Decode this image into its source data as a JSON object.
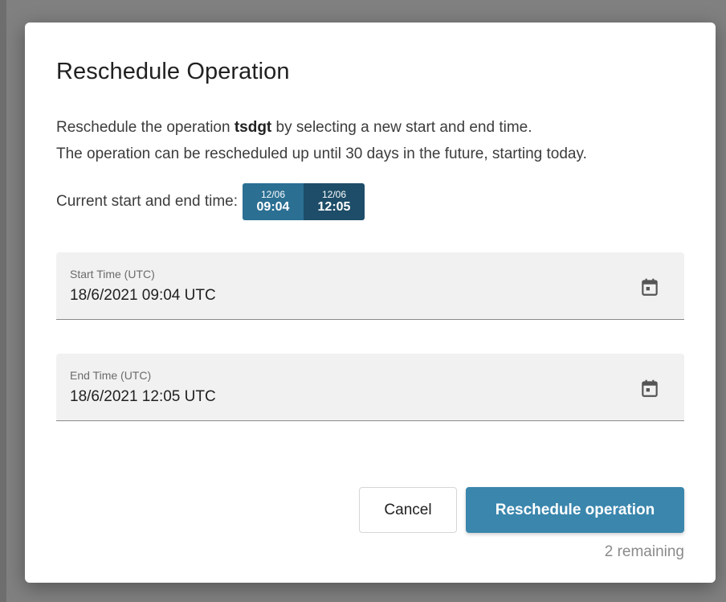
{
  "dialog": {
    "title": "Reschedule Operation",
    "description_prefix": "Reschedule the operation ",
    "operation_name": "tsdgt",
    "description_suffix": " by selecting a new start and end time.",
    "description_line2": "The operation can be rescheduled up until 30 days in the future, starting today.",
    "current_label": "Current start and end time:",
    "current_start": {
      "date": "12/06",
      "time": "09:04"
    },
    "current_end": {
      "date": "12/06",
      "time": "12:05"
    }
  },
  "fields": {
    "start": {
      "label": "Start Time (UTC)",
      "value": "18/6/2021 09:04 UTC",
      "icon": "calendar-icon"
    },
    "end": {
      "label": "End Time (UTC)",
      "value": "18/6/2021 12:05 UTC",
      "icon": "calendar-icon"
    }
  },
  "actions": {
    "cancel_label": "Cancel",
    "submit_label": "Reschedule operation",
    "remaining_text": "2 remaining"
  },
  "colors": {
    "primary": "#3a86ad",
    "badge_start": "#2b6f93",
    "badge_end": "#1d4d68",
    "field_bg": "#f1f1f1",
    "backdrop": "#808080"
  }
}
